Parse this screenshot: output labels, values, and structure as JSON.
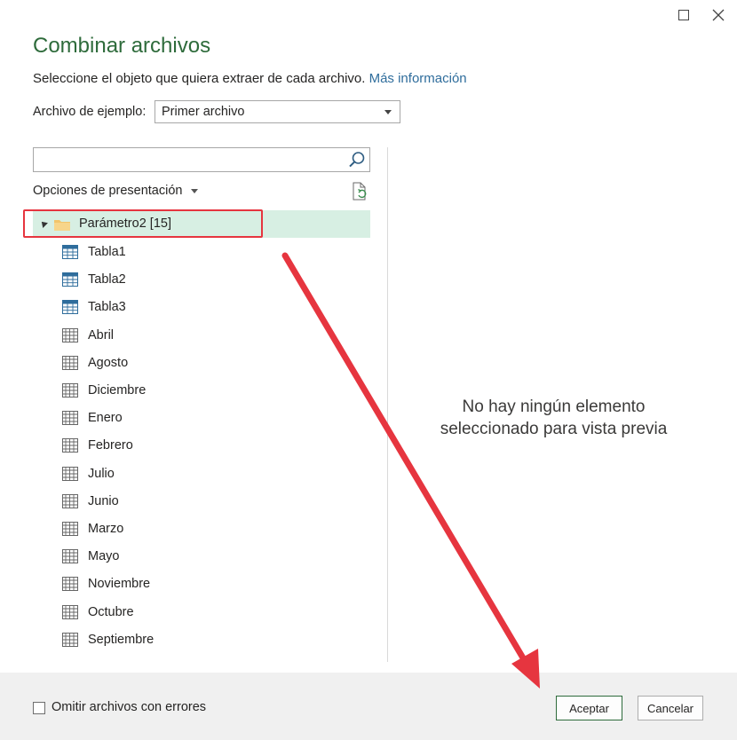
{
  "dialog": {
    "title": "Combinar archivos",
    "subtitle": "Seleccione el objeto que quiera extraer de cada archivo.",
    "more_info_link": "Más información"
  },
  "example_file": {
    "label": "Archivo de ejemplo:",
    "selected": "Primer archivo"
  },
  "search": {
    "value": "",
    "placeholder": ""
  },
  "display_options": {
    "label": "Opciones de presentación"
  },
  "tree": {
    "folder_label": "Parámetro2 [15]",
    "items": [
      {
        "label": "Tabla1",
        "icon": "table-icon"
      },
      {
        "label": "Tabla2",
        "icon": "table-icon"
      },
      {
        "label": "Tabla3",
        "icon": "table-icon"
      },
      {
        "label": "Abril",
        "icon": "sheet-icon"
      },
      {
        "label": "Agosto",
        "icon": "sheet-icon"
      },
      {
        "label": "Diciembre",
        "icon": "sheet-icon"
      },
      {
        "label": "Enero",
        "icon": "sheet-icon"
      },
      {
        "label": "Febrero",
        "icon": "sheet-icon"
      },
      {
        "label": "Julio",
        "icon": "sheet-icon"
      },
      {
        "label": "Junio",
        "icon": "sheet-icon"
      },
      {
        "label": "Marzo",
        "icon": "sheet-icon"
      },
      {
        "label": "Mayo",
        "icon": "sheet-icon"
      },
      {
        "label": "Noviembre",
        "icon": "sheet-icon"
      },
      {
        "label": "Octubre",
        "icon": "sheet-icon"
      },
      {
        "label": "Septiembre",
        "icon": "sheet-icon"
      }
    ]
  },
  "preview": {
    "empty_line1": "No hay ningún elemento",
    "empty_line2": "seleccionado para vista previa"
  },
  "footer": {
    "skip_errors_label": "Omitir archivos con errores",
    "skip_errors_checked": false,
    "ok_label": "Aceptar",
    "cancel_label": "Cancelar"
  },
  "colors": {
    "title_green": "#2e6b3b",
    "selection_bg": "#d7efe3",
    "annotation_red": "#e6353f",
    "link_blue": "#2f6d9c"
  }
}
